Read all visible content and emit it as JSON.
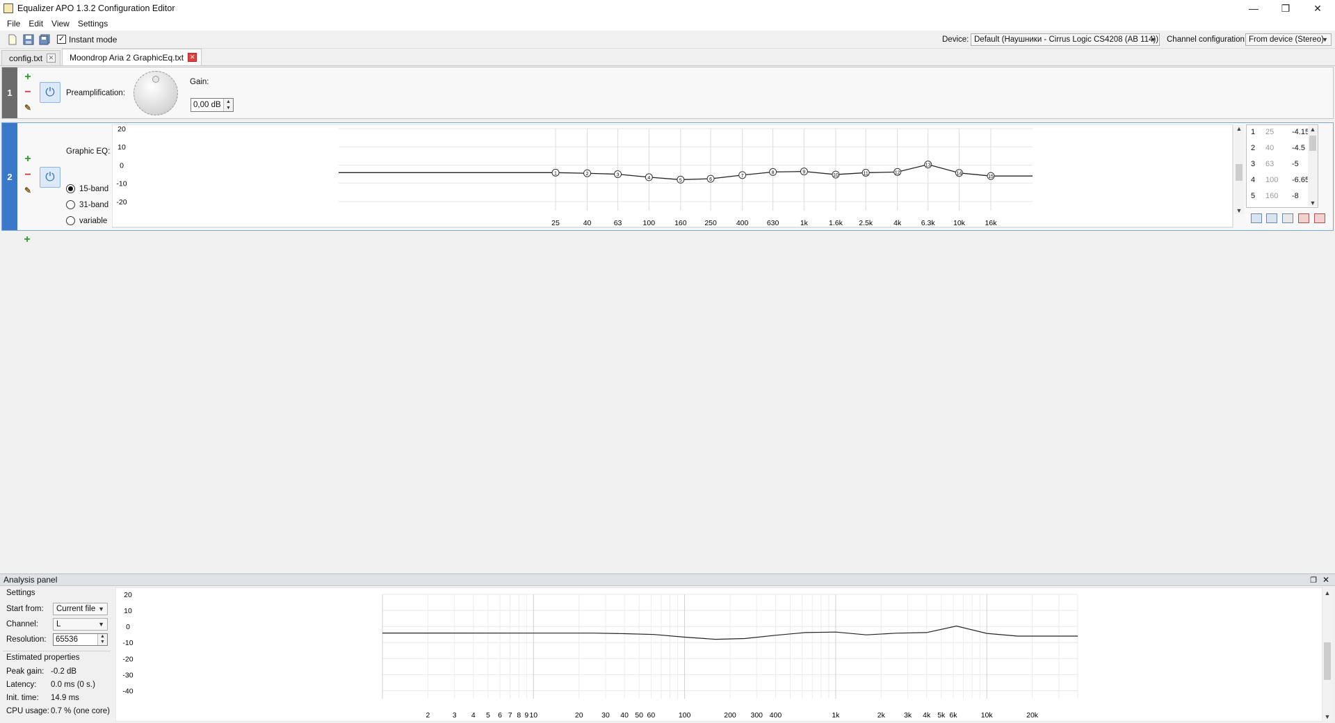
{
  "window": {
    "title": "Equalizer APO 1.3.2 Configuration Editor",
    "controls": {
      "minimize": "—",
      "restore": "❐",
      "close": "✕"
    }
  },
  "menu": [
    "File",
    "Edit",
    "View",
    "Settings"
  ],
  "toolbar": {
    "instant_mode_label": "Instant mode",
    "instant_mode_checked": true,
    "device_label": "Device:",
    "device_value": "Default (Наушники - Cirrus Logic CS4208 (AB 114))",
    "channel_config_label": "Channel configuration:",
    "channel_config_value": "From device (Stereo)",
    "icons": [
      "new-file-icon",
      "save-icon",
      "save-all-icon"
    ]
  },
  "tabs": [
    {
      "label": "config.txt",
      "active": false
    },
    {
      "label": "Moondrop Aria 2 GraphicEq.txt",
      "active": true
    }
  ],
  "filters": [
    {
      "number": "1",
      "label": "Preamplification:",
      "gain_label": "Gain:",
      "gain_value": "0,00 dB"
    },
    {
      "number": "2",
      "label": "Graphic EQ:",
      "modes": [
        "15-band",
        "31-band",
        "variable"
      ],
      "selected_mode": "15-band",
      "chart_data": {
        "type": "line",
        "y_ticks": [
          "20",
          "10",
          "0",
          "-10",
          "-20"
        ],
        "ylim": [
          -25,
          20
        ],
        "x_ticks": [
          "25",
          "40",
          "63",
          "100",
          "160",
          "250",
          "400",
          "630",
          "1k",
          "1.6k",
          "2.5k",
          "4k",
          "6.3k",
          "10k",
          "16k"
        ],
        "bands": [
          {
            "n": "1",
            "freq": 25,
            "gain": -4.15
          },
          {
            "n": "2",
            "freq": 40,
            "gain": -4.5
          },
          {
            "n": "3",
            "freq": 63,
            "gain": -5
          },
          {
            "n": "4",
            "freq": 100,
            "gain": -6.65
          },
          {
            "n": "5",
            "freq": 160,
            "gain": -8
          },
          {
            "n": "6",
            "freq": 250,
            "gain": -7.5
          },
          {
            "n": "7",
            "freq": 400,
            "gain": -5.5
          },
          {
            "n": "8",
            "freq": 630,
            "gain": -3.8
          },
          {
            "n": "9",
            "freq": 1000,
            "gain": -3.5
          },
          {
            "n": "10",
            "freq": 1600,
            "gain": -5.2
          },
          {
            "n": "11",
            "freq": 2500,
            "gain": -4.2
          },
          {
            "n": "12",
            "freq": 4000,
            "gain": -3.8
          },
          {
            "n": "13",
            "freq": 6300,
            "gain": 0.3
          },
          {
            "n": "14",
            "freq": 10000,
            "gain": -4.3
          },
          {
            "n": "15",
            "freq": 16000,
            "gain": -6
          }
        ]
      },
      "table": [
        {
          "n": "1",
          "freq": "25",
          "gain": "-4.15"
        },
        {
          "n": "2",
          "freq": "40",
          "gain": "-4.5"
        },
        {
          "n": "3",
          "freq": "63",
          "gain": "-5"
        },
        {
          "n": "4",
          "freq": "100",
          "gain": "-6.65"
        },
        {
          "n": "5",
          "freq": "160",
          "gain": "-8"
        }
      ]
    }
  ],
  "analysis": {
    "title": "Analysis panel",
    "settings_label": "Settings",
    "start_from_label": "Start from:",
    "start_from_value": "Current file",
    "channel_label": "Channel:",
    "channel_value": "L",
    "resolution_label": "Resolution:",
    "resolution_value": "65536",
    "estimated_label": "Estimated properties",
    "props": [
      {
        "label": "Peak gain:",
        "value": "-0.2 dB"
      },
      {
        "label": "Latency:",
        "value": "0.0 ms (0 s.)"
      },
      {
        "label": "Init. time:",
        "value": "14.9 ms"
      },
      {
        "label": "CPU usage:",
        "value": "0.7 % (one core)"
      }
    ],
    "chart_data": {
      "type": "line",
      "y_ticks": [
        "20",
        "10",
        "0",
        "-10",
        "-20",
        "-30",
        "-40"
      ],
      "ylim": [
        -45,
        20
      ],
      "x_ticks": [
        "2",
        "3",
        "4",
        "5",
        "6",
        "7",
        "8",
        "9",
        "10",
        "20",
        "30",
        "40",
        "50",
        "60",
        "100",
        "200",
        "300",
        "400",
        "1k",
        "2k",
        "3k",
        "4k",
        "5k",
        "6k",
        "10k",
        "20k"
      ],
      "x_tick_values": [
        2,
        3,
        4,
        5,
        6,
        7,
        8,
        9,
        10,
        20,
        30,
        40,
        50,
        60,
        100,
        200,
        300,
        400,
        1000,
        2000,
        3000,
        4000,
        5000,
        6000,
        10000,
        20000
      ],
      "xlim": [
        1,
        40000
      ],
      "response": [
        [
          1,
          -4.1
        ],
        [
          25,
          -4.15
        ],
        [
          40,
          -4.5
        ],
        [
          63,
          -5
        ],
        [
          100,
          -6.65
        ],
        [
          160,
          -8
        ],
        [
          250,
          -7.5
        ],
        [
          400,
          -5.5
        ],
        [
          630,
          -3.8
        ],
        [
          1000,
          -3.5
        ],
        [
          1600,
          -5.2
        ],
        [
          2500,
          -4.2
        ],
        [
          4000,
          -3.8
        ],
        [
          6300,
          0.3
        ],
        [
          10000,
          -4.3
        ],
        [
          16000,
          -6
        ],
        [
          40000,
          -6
        ]
      ]
    }
  }
}
